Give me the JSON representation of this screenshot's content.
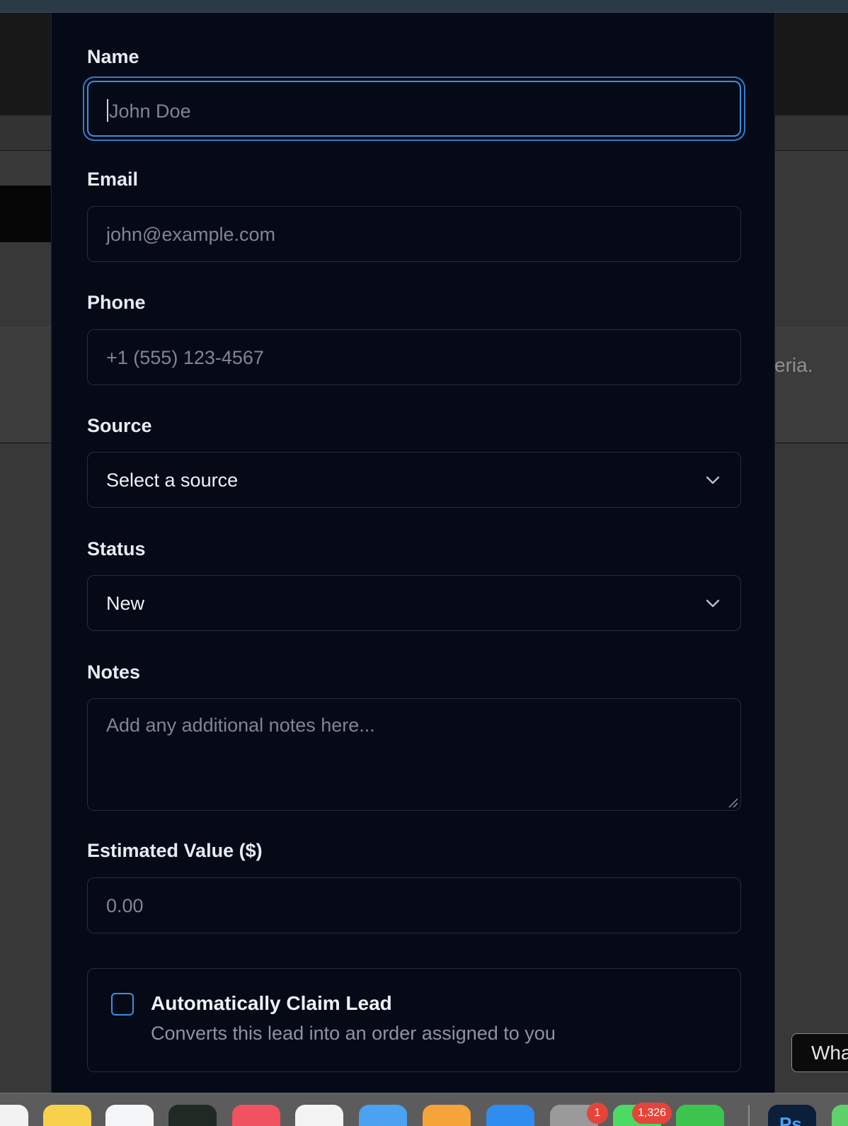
{
  "background": {
    "text_fragment": "eria.",
    "corner_button_label": "Wha"
  },
  "form": {
    "name": {
      "label": "Name",
      "placeholder": "John Doe",
      "focused": true
    },
    "email": {
      "label": "Email",
      "placeholder": "john@example.com"
    },
    "phone": {
      "label": "Phone",
      "placeholder": "+1 (555) 123-4567"
    },
    "source": {
      "label": "Source",
      "selected": "Select a source"
    },
    "status": {
      "label": "Status",
      "selected": "New"
    },
    "notes": {
      "label": "Notes",
      "placeholder": "Add any additional notes here..."
    },
    "estimated_value": {
      "label": "Estimated Value ($)",
      "placeholder": "0.00"
    },
    "auto_claim": {
      "title": "Automatically Claim Lead",
      "description": "Converts this lead into an order assigned to you",
      "checked": false
    }
  },
  "dock": {
    "icons": [
      {
        "name": "finder-icon",
        "color": "#f2f2f2"
      },
      {
        "name": "notes-icon",
        "color": "#f7d14c"
      },
      {
        "name": "preview-icon",
        "color": "#f4f6f8"
      },
      {
        "name": "tv-icon",
        "color": "#1f2a24"
      },
      {
        "name": "music-icon",
        "color": "#f0525f"
      },
      {
        "name": "news-icon",
        "color": "#f3f3f3"
      },
      {
        "name": "keynote-icon",
        "color": "#4aa2f0"
      },
      {
        "name": "pages-icon",
        "color": "#f4a438"
      },
      {
        "name": "app-store-icon",
        "color": "#2f8df0"
      },
      {
        "name": "system-settings-icon",
        "color": "#9a9a9a"
      },
      {
        "name": "messages-icon",
        "color": "#4cd964"
      },
      {
        "name": "numbers-icon",
        "color": "#3cc44f"
      },
      {
        "name": "photoshop-icon",
        "color": "#0b1f3b"
      },
      {
        "name": "partial-app-icon",
        "color": "#5fd16a"
      }
    ],
    "badges": {
      "system_settings": "1",
      "messages": "1,326"
    },
    "photoshop_label": "Ps"
  }
}
